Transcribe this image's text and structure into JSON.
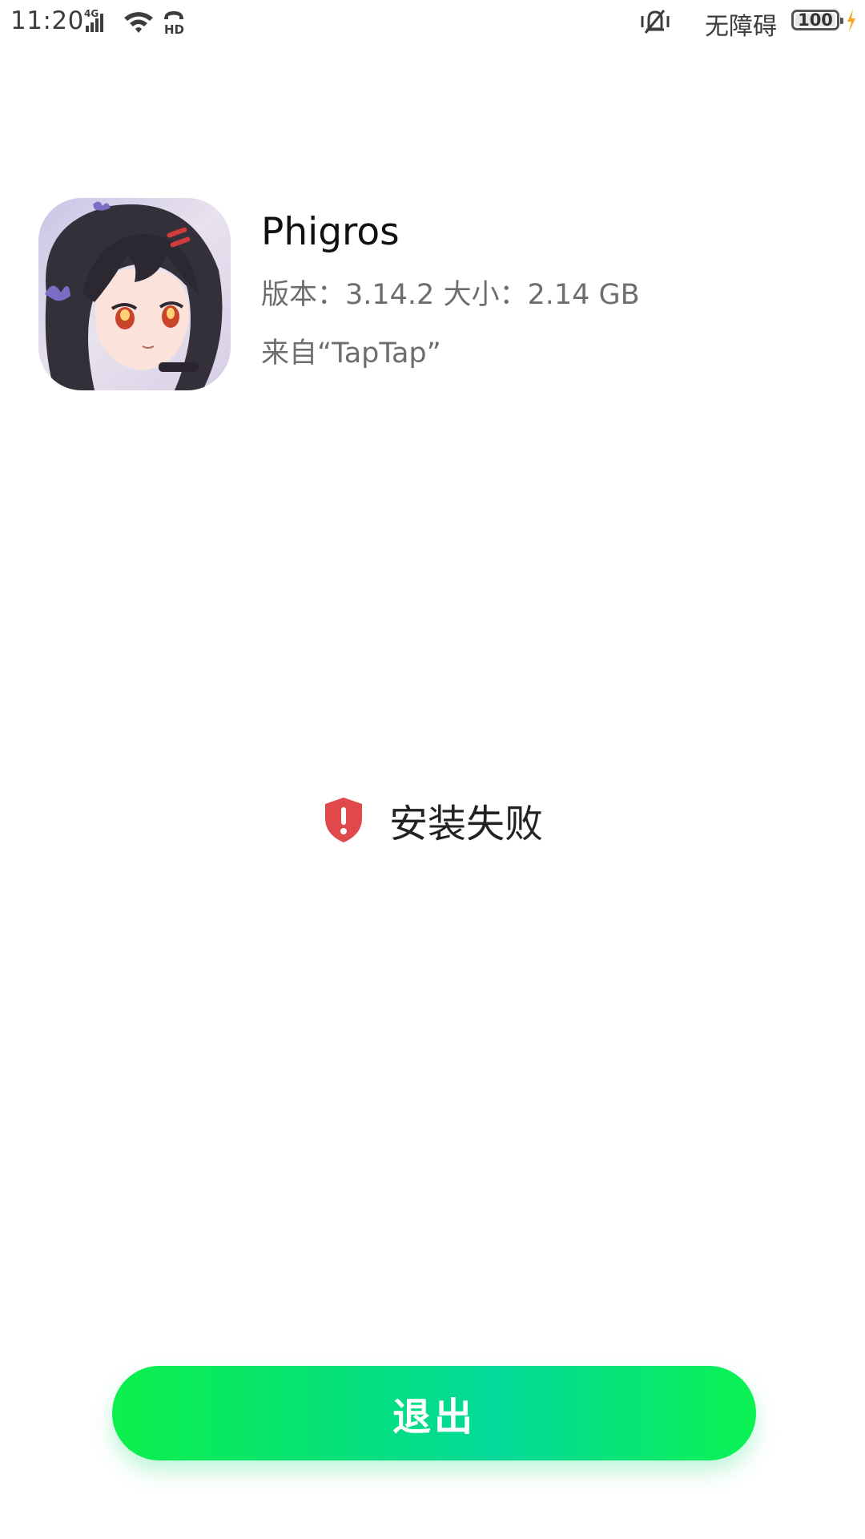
{
  "status_bar": {
    "time": "11:20",
    "network": "4G",
    "hd_label": "HD",
    "accessibility": "无障碍",
    "battery": "100",
    "icons": [
      "signal-icon",
      "wifi-icon",
      "hd-call-icon",
      "vibrate-icon",
      "battery-icon",
      "charging-icon"
    ]
  },
  "app": {
    "icon": "phigros-app-icon",
    "name": "Phigros",
    "version_size": "版本：3.14.2  大小：2.14 GB",
    "source": "来自“TapTap”"
  },
  "result": {
    "icon": "shield-warning-icon",
    "text": "安装失败",
    "icon_color": "#e0484c"
  },
  "actions": {
    "exit_label": "退出",
    "accent_color": "#04dd86"
  }
}
